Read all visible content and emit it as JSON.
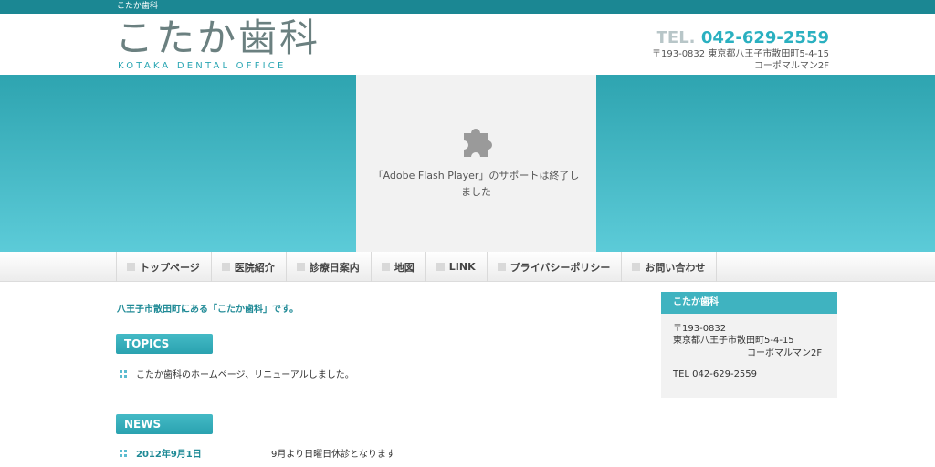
{
  "topbar": {
    "text": "こたか歯科"
  },
  "header": {
    "logo_main": "こたか歯科",
    "logo_sub": "KOTAKA DENTAL OFFICE",
    "tel_label": "TEL.",
    "tel_number": "042-629-2559",
    "address_line1": "〒193-0832 東京都八王子市散田町5-4-15",
    "address_line2": "コーポマルマン2F"
  },
  "hero": {
    "flash_line1": "「Adobe Flash Player」のサポートは終了し",
    "flash_line2": "ました"
  },
  "nav": {
    "items": [
      {
        "label": "トップページ"
      },
      {
        "label": "医院紹介"
      },
      {
        "label": "診療日案内"
      },
      {
        "label": "地図"
      },
      {
        "label": "LINK"
      },
      {
        "label": "プライバシーポリシー"
      },
      {
        "label": "お問い合わせ"
      }
    ]
  },
  "main": {
    "intro": "八王子市散田町にある「こたか歯科」です。",
    "topics": {
      "heading": "TOPICS",
      "items": [
        {
          "text": "こたか歯科のホームページ、リニューアルしました。"
        }
      ]
    },
    "news": {
      "heading": "NEWS",
      "items": [
        {
          "date": "2012年9月1日",
          "text": "9月より日曜日休診となります"
        }
      ]
    }
  },
  "sidebar": {
    "title": "こたか歯科",
    "zip": "〒193-0832",
    "address": "東京都八王子市散田町5-4-15",
    "building": "コーポマルマン2F",
    "tel": "TEL 042-629-2559"
  },
  "colors": {
    "brand_teal": "#2aa6b3",
    "topbar": "#1b8793",
    "logo_gray": "#6b8080"
  },
  "icons": {
    "flash_placeholder": "puzzle-piece-icon",
    "nav_bullet": "square-bullet-icon",
    "list_bullet": "grid-bullet-icon"
  }
}
